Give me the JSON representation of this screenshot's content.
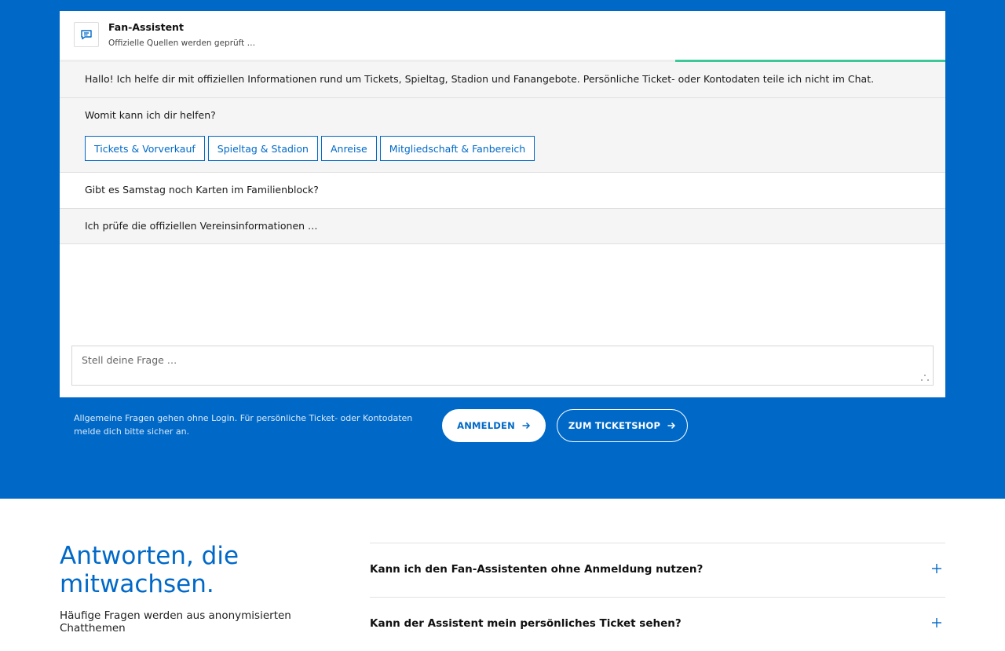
{
  "chat": {
    "title": "Fan-Assistent",
    "status": "Offizielle Quellen werden geprüft …",
    "progress": 0.305,
    "messages": [
      {
        "role": "bot",
        "text": "Hallo! Ich helfe dir mit offiziellen Informationen rund um Tickets, Spieltag, Stadion und Fanangebote. Persönliche Ticket- oder Kontodaten teile ich nicht im Chat."
      },
      {
        "role": "bot",
        "text": "Womit kann ich dir helfen?"
      },
      {
        "role": "user",
        "text": "Gibt es Samstag noch Karten im Familienblock?"
      },
      {
        "role": "bot",
        "text": "Ich prüfe die offiziellen Vereinsinformationen …"
      }
    ],
    "quick_replies": [
      "Tickets & Vorverkauf",
      "Spieltag & Stadion",
      "Anreise",
      "Mitgliedschaft & Fanbereich"
    ],
    "input_placeholder": "Stell deine Frage …"
  },
  "band": {
    "note": "Allgemeine Fragen gehen ohne Login. Für persönliche Ticket- oder Kontodaten melde dich bitte sicher an.",
    "login_label": "ANMELDEN",
    "shop_label": "ZUM TICKETSHOP"
  },
  "faq": {
    "heading": "Antworten, die mitwachsen.",
    "intro": "Häufige Fragen werden aus anonymisierten Chatthemen",
    "items": [
      "Kann ich den Fan-Assistenten ohne Anmeldung nutzen?",
      "Kann der Assistent mein persönliches Ticket sehen?"
    ]
  },
  "colors": {
    "brand_blue": "#0069c8",
    "progress_green": "#3dc897",
    "bot_bg": "#f5f5f5"
  },
  "icons": {
    "assistant": "chat-bubble-icon",
    "button_arrow": "arrow-right-icon",
    "faq_toggle": "plus-icon",
    "input_resize": "resize-grip-icon"
  }
}
